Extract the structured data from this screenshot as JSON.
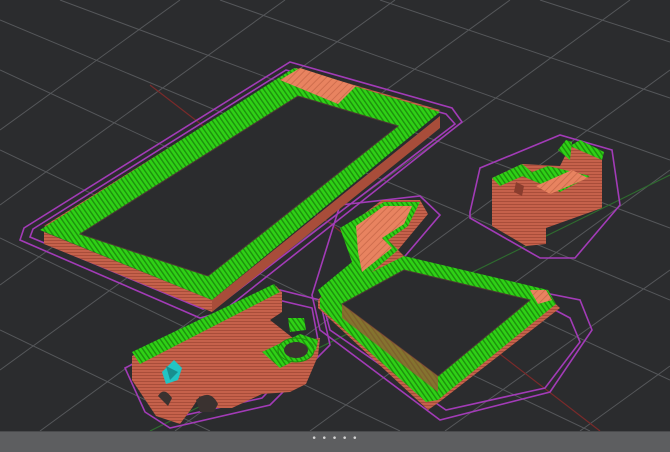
{
  "viewport": {
    "bed_grid": "on",
    "colors": {
      "background": "#2b2c2e",
      "grid": "#55575a",
      "axis_x": "#7a2a2a",
      "axis_y": "#2e6b2e",
      "wall": "#c5614b",
      "wall_dark": "#a84d3a",
      "infill": "#e88360",
      "perimeter": "#2fd116",
      "perimeter_dark": "#1d8f0d",
      "skirt": "#a23bb7",
      "support": "#22c4c4"
    }
  },
  "statusbar": {
    "handle_glyph": "• • • • •"
  }
}
